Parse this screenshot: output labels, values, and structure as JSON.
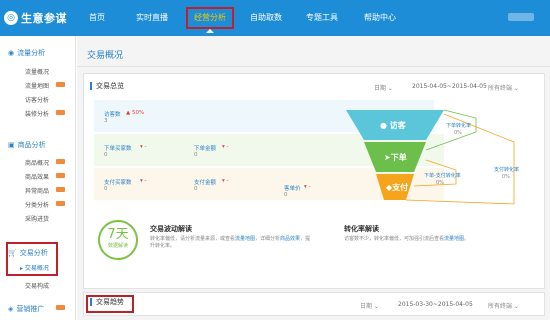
{
  "app": {
    "name": "生意参谋"
  },
  "nav": {
    "items": [
      {
        "label": "首页"
      },
      {
        "label": "实时直播"
      },
      {
        "label": "经营分析"
      },
      {
        "label": "自助取数"
      },
      {
        "label": "专题工具"
      },
      {
        "label": "帮助中心"
      }
    ],
    "active_index": 2
  },
  "sidebar": {
    "groups": [
      {
        "title": "流量分析",
        "items": [
          "流量概况",
          "流量地图",
          "访客分析",
          "装修分析"
        ]
      },
      {
        "title": "商品分析",
        "items": [
          "商品概况",
          "商品效果",
          "异常商品",
          "分类分析",
          "采购进货"
        ]
      },
      {
        "title": "交易分析",
        "items": [
          "交易概况",
          "交易构成"
        ]
      },
      {
        "title": "营销推广"
      }
    ],
    "current_item": "交易概况"
  },
  "main": {
    "page_title": "交易概况",
    "overview": {
      "heading": "交易总览",
      "date_label": "日期",
      "date_range": "2015-04-05~2015-04-05",
      "terminal_label": "所有终端"
    },
    "metrics": [
      {
        "label": "访客数",
        "value": "3",
        "change": "50%"
      },
      {
        "label": "下单买家数",
        "value": "0"
      },
      {
        "label": "下单金额",
        "value": "0"
      },
      {
        "label": "支付买家数",
        "value": "0"
      },
      {
        "label": "支付金额",
        "value": "0"
      },
      {
        "label": "客单价",
        "value": "0"
      }
    ],
    "funnel": {
      "stages": [
        "访客",
        "下单",
        "支付"
      ],
      "conversions": [
        {
          "label": "下单转化率",
          "value": "0%"
        },
        {
          "label": "下单-支付转化率",
          "value": "0%"
        },
        {
          "label": "支付转化率",
          "value": "0%"
        }
      ]
    },
    "interpretation": {
      "badge_number": "7天",
      "badge_caption": "数据解读",
      "wave_title": "交易波动解读",
      "wave_text_1": "转化率偏低，请分析流量来源，或查看",
      "wave_link_1": "流量地图",
      "wave_text_2": "，详细分析",
      "wave_link_2": "商品效果",
      "wave_text_3": "，提升转化率。",
      "conv_title": "转化率解读",
      "conv_text": "访客数不少，转化率偏低，可加强引流后查看",
      "conv_link": "流量地图",
      "conv_end": "。"
    },
    "trend": {
      "heading": "交易趋势",
      "date_label": "日期",
      "date_range": "2015-03-30~2015-04-05",
      "terminal_label": "所有终端"
    }
  },
  "colors": {
    "topbar": "#1c8dd6",
    "accent": "#2a82c8",
    "highlight": "#c0202a",
    "funnel_visit": "#5bc5d9",
    "funnel_order": "#6cbf4a",
    "funnel_pay": "#f5a51c"
  },
  "icons": [
    "logo-icon",
    "eye-icon",
    "bag-icon",
    "cart-icon",
    "megaphone-icon",
    "user-icon",
    "cursor-icon",
    "coin-icon"
  ]
}
